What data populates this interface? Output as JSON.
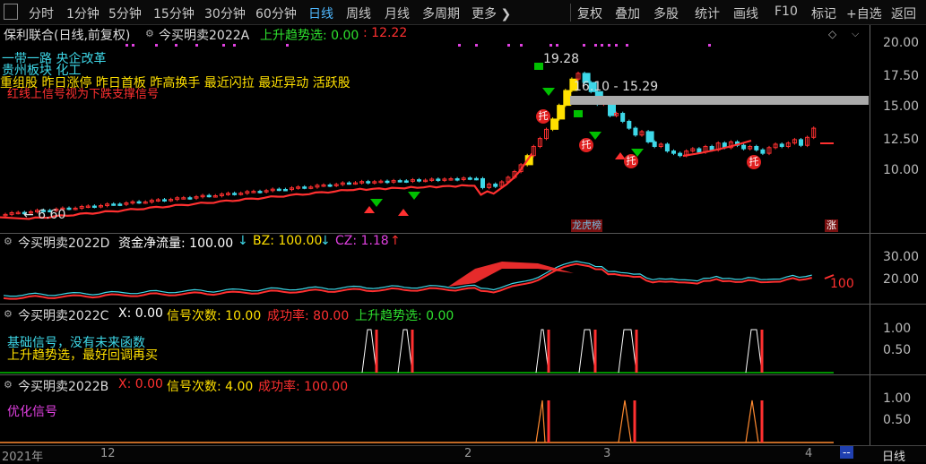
{
  "toolbar": {
    "periods": [
      "分时",
      "1分钟",
      "5分钟",
      "15分钟",
      "30分钟",
      "60分钟",
      "日线",
      "周线",
      "月线",
      "多周期",
      "更多 ❯"
    ],
    "active_period": "日线",
    "right_buttons": [
      "复权",
      "叠加",
      "多股",
      "统计",
      "画线",
      "F10",
      "标记",
      "+自选",
      "返回"
    ]
  },
  "main": {
    "stock_name": "保利联合(日线,前复权)",
    "indicator_name": "今买明卖2022A",
    "trend_label": "上升趋势选: 0.00",
    "price_value": ": 12.22",
    "sector_line1": "一带一路  央企改革",
    "sector_line2": "贵州板块  化工",
    "concepts": "重组股 昨日涨停 昨日首板 昨高换手 最近闪拉 最近异动 活跃股",
    "note": "红线上信号视为下跌支撑信号",
    "high_label": "19.28",
    "range_label": "16.10 - 15.29",
    "low_label": "← 6.60",
    "tuo_label": "托",
    "longhu_label": "龙虎榜",
    "zhang_label": "涨",
    "yticks": [
      "20.00",
      "17.50",
      "15.00",
      "12.50",
      "10.00"
    ]
  },
  "panel_d": {
    "name": "今买明卖2022D",
    "flow": "资金净流量: 100.00",
    "bz": "BZ: 100.00",
    "cz": "CZ: 1.18",
    "value_label": "100",
    "yticks": [
      "30.00",
      "20.00"
    ]
  },
  "panel_c": {
    "name": "今买明卖2022C",
    "x": "X: 0.00",
    "signals": "信号次数: 10.00",
    "success": "成功率: 80.00",
    "trend": "上升趋势选: 0.00",
    "note1": "基础信号，没有未来函数",
    "note2": "上升趋势选，最好回调再买",
    "yticks": [
      "1.00",
      "0.50"
    ]
  },
  "panel_b": {
    "name": "今买明卖2022B",
    "x": "X: 0.00",
    "signals": "信号次数: 4.00",
    "success": "成功率: 100.00",
    "note": "优化信号",
    "yticks": [
      "1.00",
      "0.50"
    ]
  },
  "time_axis": {
    "labels": [
      "2021年",
      "12",
      "2",
      "3",
      "4"
    ],
    "period_tab": "日线",
    "dash": "--"
  },
  "colors": {
    "up": "#ff3030",
    "down": "#3ed8e8",
    "yellow": "#ffe000",
    "green": "#00c000",
    "magenta": "#e040e0"
  }
}
